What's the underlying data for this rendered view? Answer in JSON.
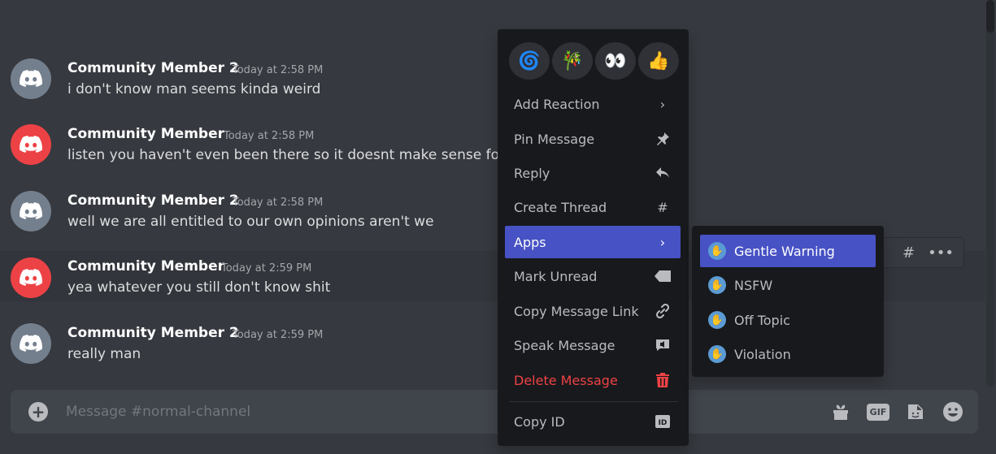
{
  "messages": [
    {
      "author": "Community Member 2",
      "time": "Today at 2:58 PM",
      "text": "i don't know man seems kinda weird",
      "avatar_color": "grey"
    },
    {
      "author": "Community Member",
      "time": "Today at 2:58 PM",
      "text": "listen you haven't even been there so it doesnt make sense for yo",
      "avatar_color": "red"
    },
    {
      "author": "Community Member 2",
      "time": "Today at 2:58 PM",
      "text": "well we are all entitled to our own opinions aren't we",
      "avatar_color": "grey"
    },
    {
      "author": "Community Member",
      "time": "Today at 2:59 PM",
      "text": "yea whatever you still don't know shit",
      "avatar_color": "red"
    },
    {
      "author": "Community Member 2",
      "time": "Today at 2:59 PM",
      "text": "really man",
      "avatar_color": "grey"
    }
  ],
  "composer": {
    "placeholder": "Message #normal-channel",
    "icons": [
      "plus-icon",
      "gift-icon",
      "gif-icon",
      "sticker-icon",
      "emoji-icon"
    ],
    "gif_label": "GIF"
  },
  "context_menu": {
    "reactions": [
      "🌀",
      "🎋",
      "👀",
      "👍"
    ],
    "items": [
      {
        "label": "Add Reaction",
        "icon": "chevron-right-icon"
      },
      {
        "label": "Pin Message",
        "icon": "pin-icon"
      },
      {
        "label": "Reply",
        "icon": "reply-icon"
      },
      {
        "label": "Create Thread",
        "icon": "thread-icon"
      },
      {
        "label": "Apps",
        "icon": "chevron-right-icon",
        "active": true
      },
      {
        "label": "Mark Unread",
        "icon": "mark-unread-icon"
      },
      {
        "label": "Copy Message Link",
        "icon": "link-icon"
      },
      {
        "label": "Speak Message",
        "icon": "speak-icon"
      },
      {
        "label": "Delete Message",
        "icon": "trash-icon",
        "danger": true
      },
      {
        "label": "Copy ID",
        "icon": "id-icon"
      }
    ]
  },
  "apps_submenu": {
    "items": [
      {
        "label": "Gentle Warning",
        "active": true
      },
      {
        "label": "NSFW"
      },
      {
        "label": "Off Topic"
      },
      {
        "label": "Violation"
      }
    ]
  },
  "colors": {
    "background": "#36393f",
    "menu": "#18191c",
    "accent": "#4752c4",
    "danger": "#ed4245",
    "avatar_grey": "#747f8d",
    "avatar_red": "#ed4245"
  }
}
